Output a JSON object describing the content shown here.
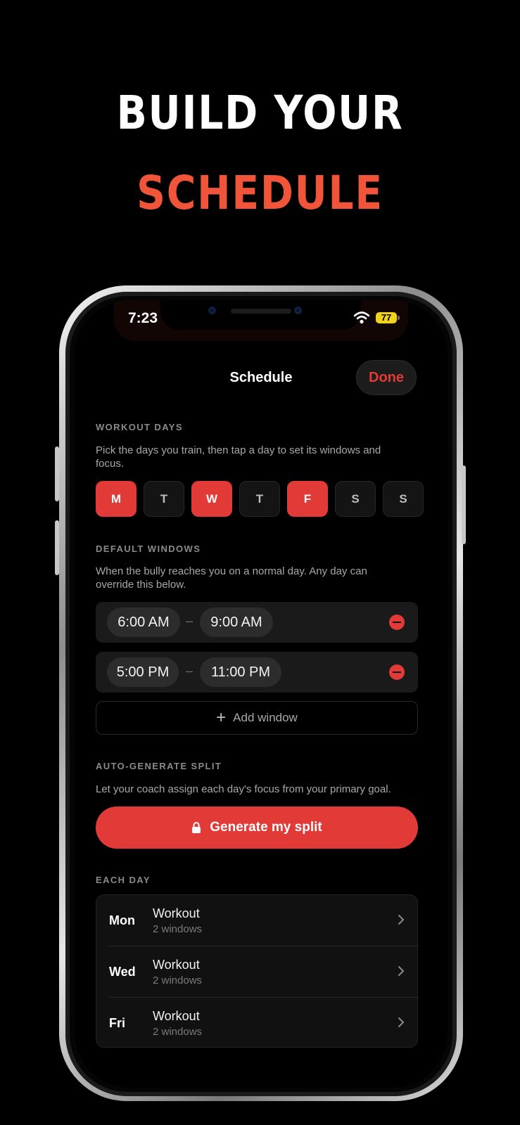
{
  "headline": {
    "line1": "BUILD YOUR",
    "line2": "SCHEDULE"
  },
  "status_bar": {
    "time": "7:23",
    "battery": "77"
  },
  "nav": {
    "title": "Schedule",
    "done_label": "Done"
  },
  "workout_days": {
    "header": "WORKOUT DAYS",
    "description": "Pick the days you train, then tap a day to set its windows and focus.",
    "days": [
      {
        "label": "M",
        "selected": true
      },
      {
        "label": "T",
        "selected": false
      },
      {
        "label": "W",
        "selected": true
      },
      {
        "label": "T",
        "selected": false
      },
      {
        "label": "F",
        "selected": true
      },
      {
        "label": "S",
        "selected": false
      },
      {
        "label": "S",
        "selected": false
      }
    ]
  },
  "default_windows": {
    "header": "DEFAULT WINDOWS",
    "description": "When the bully reaches you on a normal day. Any day can override this below.",
    "windows": [
      {
        "start": "6:00 AM",
        "separator": "–",
        "end": "9:00 AM"
      },
      {
        "start": "5:00 PM",
        "separator": "–",
        "end": "11:00 PM"
      }
    ],
    "add_label": "Add window",
    "add_icon": "+"
  },
  "auto_split": {
    "header": "AUTO-GENERATE SPLIT",
    "description": "Let your coach assign each day's focus from your primary goal.",
    "button_label": "Generate my split",
    "button_icon": "lock-icon"
  },
  "each_day": {
    "header": "EACH DAY",
    "items": [
      {
        "day": "Mon",
        "focus": "Workout",
        "windows": "2 windows"
      },
      {
        "day": "Wed",
        "focus": "Workout",
        "windows": "2 windows"
      },
      {
        "day": "Fri",
        "focus": "Workout",
        "windows": "2 windows"
      }
    ]
  },
  "colors": {
    "accent": "#e23a36",
    "headline_accent": "#f0553a",
    "background": "#000000",
    "battery": "#f2d21a"
  }
}
